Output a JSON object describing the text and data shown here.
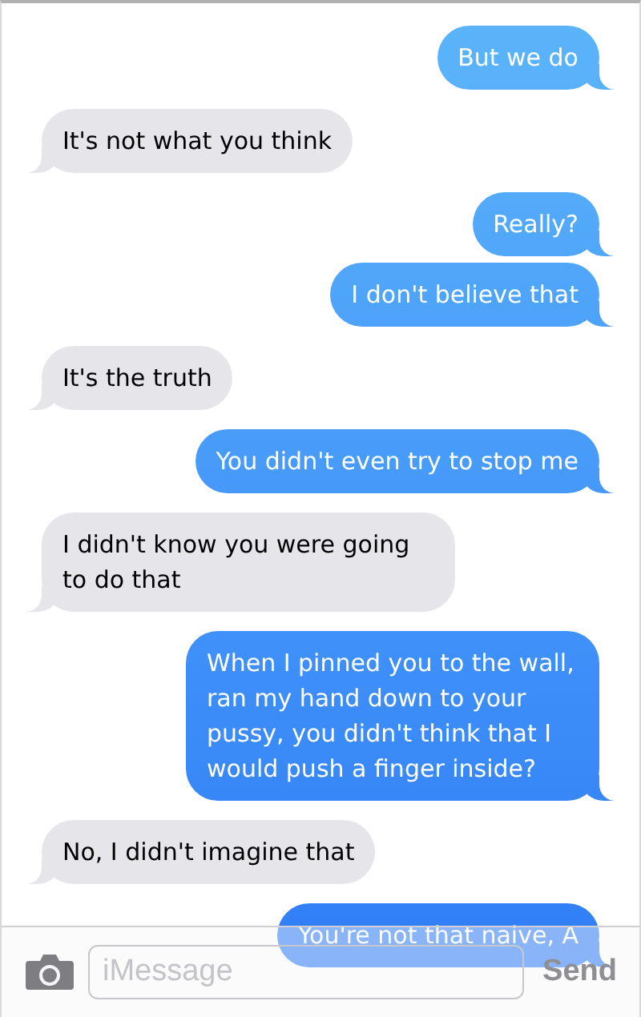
{
  "messages": [
    {
      "kind": "sent",
      "text": "But we do"
    },
    {
      "kind": "received",
      "text": "It's not what you think"
    },
    {
      "kind": "sent",
      "text": "Really?"
    },
    {
      "kind": "sent",
      "text": "I don't believe that"
    },
    {
      "kind": "received",
      "text": "It's the truth"
    },
    {
      "kind": "sent",
      "text": "You didn't even try to stop me"
    },
    {
      "kind": "received",
      "text": "I didn't know you were going to do that"
    },
    {
      "kind": "sent",
      "text": "When I pinned you to the wall, ran my hand down to your pussy, you didn't think that I would push a finger inside?"
    },
    {
      "kind": "received",
      "text": "No, I didn't imagine that"
    },
    {
      "kind": "sent",
      "text": "You're not that naive, A"
    }
  ],
  "composer": {
    "placeholder": "iMessage",
    "send": "Send"
  }
}
